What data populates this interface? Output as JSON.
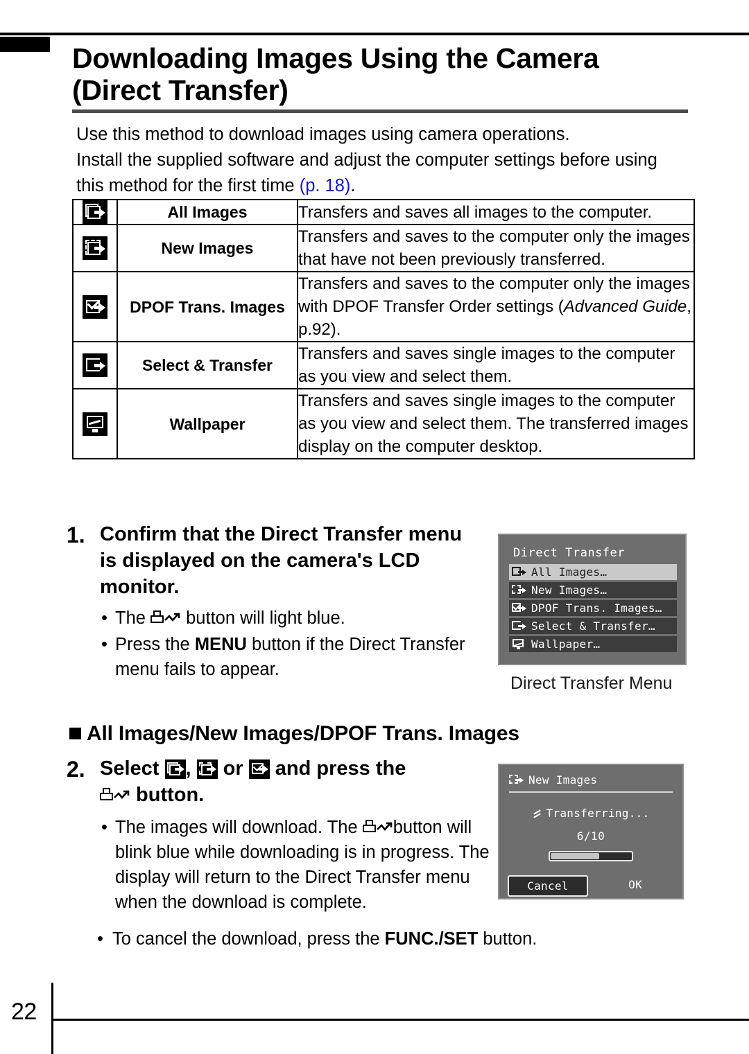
{
  "page": {
    "number": "22"
  },
  "heading": {
    "line1": "Downloading Images Using the Camera",
    "line2": "(Direct Transfer)"
  },
  "intro": {
    "line1": "Use this method to download images using camera operations.",
    "line2": "Install the supplied software and adjust the computer settings before using",
    "line3_before": "this method for the first time ",
    "line3_link": "(p. 18)",
    "line3_after": "."
  },
  "table": {
    "rows": [
      {
        "icon": "all-images-icon",
        "name": "All Images",
        "desc": "Transfers and saves all images to the computer."
      },
      {
        "icon": "new-images-icon",
        "name": "New Images",
        "desc": "Transfers and saves to the computer only the images that have not been previously transferred."
      },
      {
        "icon": "dpof-trans-images-icon",
        "name": "DPOF Trans. Images",
        "desc_part1": "Transfers and saves to the computer only the images with DPOF Transfer Order settings (",
        "desc_italic": "Advanced Guide",
        "desc_part2": ", p.92)."
      },
      {
        "icon": "select-transfer-icon",
        "name": "Select & Transfer",
        "desc": "Transfers and saves single images to the computer as you view and select them."
      },
      {
        "icon": "wallpaper-icon",
        "name": "Wallpaper",
        "desc": "Transfers and saves single images to the computer as you view and select them. The transferred images display on the computer desktop."
      }
    ]
  },
  "step1": {
    "number": "1.",
    "title": "Confirm that the Direct Transfer menu is displayed on the camera's LCD monitor.",
    "bullet1_before": "The ",
    "bullet1_after": " button will light blue.",
    "bullet2_before": "Press the ",
    "bullet2_bold": "MENU",
    "bullet2_after": " button if the Direct Transfer menu fails to appear."
  },
  "section_heading": {
    "text": "All Images/New Images/DPOF Trans. Images"
  },
  "step2": {
    "number": "2.",
    "title_before": "Select ",
    "title_comma": ", ",
    "title_or": " or ",
    "title_after": " and press the",
    "title_line2": " button.",
    "bullet1_before": "The images will download. The ",
    "bullet1_after": "button will blink blue while downloading is in progress. The display will return to the Direct Transfer menu when the download is complete.",
    "bullet2_before": "To cancel the download, press the ",
    "bullet2_bold": "FUNC./SET",
    "bullet2_after": " button."
  },
  "lcd_menu": {
    "title": "Direct Transfer",
    "items": [
      {
        "icon": "all-images-icon",
        "label": "All Images…",
        "selected": true
      },
      {
        "icon": "new-images-icon",
        "label": "New Images…",
        "selected": false
      },
      {
        "icon": "dpof-trans-images-icon",
        "label": "DPOF Trans. Images…",
        "selected": false
      },
      {
        "icon": "select-transfer-icon",
        "label": "Select & Transfer…",
        "selected": false
      },
      {
        "icon": "wallpaper-icon",
        "label": "Wallpaper…",
        "selected": false
      }
    ],
    "caption": "Direct Transfer Menu"
  },
  "lcd_transfer": {
    "header_icon": "new-images-icon",
    "header": "New Images",
    "status": "Transferring...",
    "count": "6/10",
    "progress_percent": 60,
    "cancel_label": "Cancel",
    "ok_label": "OK"
  },
  "colors": {
    "link": "#1414d2",
    "lcd_background": "#6e6e6e",
    "lcd_row": "#3c3c3c",
    "lcd_selected_row": "#c9c9c9"
  }
}
